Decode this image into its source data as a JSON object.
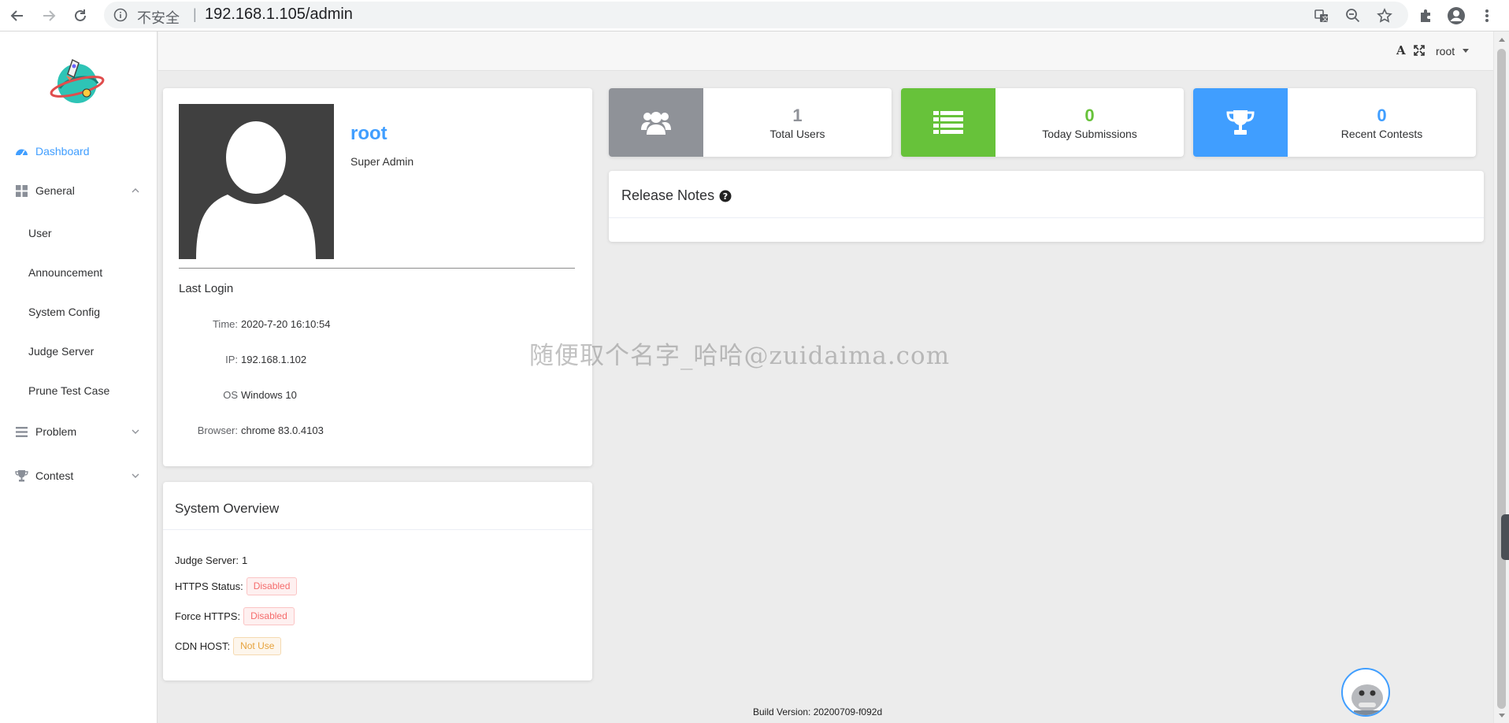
{
  "browser": {
    "insecure_label": "不安全",
    "separator": "|",
    "url": "192.168.1.105/admin"
  },
  "sidebar": {
    "dashboard": "Dashboard",
    "general": "General",
    "general_items": [
      "User",
      "Announcement",
      "System Config",
      "Judge Server",
      "Prune Test Case"
    ],
    "problem": "Problem",
    "contest": "Contest"
  },
  "header": {
    "font_icon_label": "A",
    "username": "root"
  },
  "profile": {
    "name": "root",
    "role": "Super Admin",
    "last_login_title": "Last Login",
    "rows": [
      {
        "key": "Time:",
        "value": "2020-7-20 16:10:54"
      },
      {
        "key": "IP:",
        "value": "192.168.1.102"
      },
      {
        "key": "OS",
        "value": "Windows 10"
      },
      {
        "key": "Browser:",
        "value": "chrome 83.0.4103"
      }
    ]
  },
  "stats": [
    {
      "value": "1",
      "label": "Total Users",
      "icon": "users-icon",
      "color": "#8f9298",
      "value_color": "#8f9298"
    },
    {
      "value": "0",
      "label": "Today Submissions",
      "icon": "list-icon",
      "color": "#67c23a",
      "value_color": "#67c23a"
    },
    {
      "value": "0",
      "label": "Recent Contests",
      "icon": "trophy-icon",
      "color": "#409eff",
      "value_color": "#409eff"
    }
  ],
  "release_notes": {
    "title": "Release Notes"
  },
  "overview": {
    "title": "System Overview",
    "judge_server_label": "Judge Server:",
    "judge_server_value": "1",
    "https_label": "HTTPS Status:",
    "https_value": "Disabled",
    "force_https_label": "Force HTTPS:",
    "force_https_value": "Disabled",
    "cdn_label": "CDN HOST:",
    "cdn_value": "Not Use"
  },
  "watermark": "随便取个名字_哈哈@zuidaima.com",
  "build_version": "Build Version: 20200709-f092d",
  "colors": {
    "accent": "#409eff",
    "success": "#67c23a",
    "danger": "#f56c6c",
    "warning": "#e6a23c"
  }
}
